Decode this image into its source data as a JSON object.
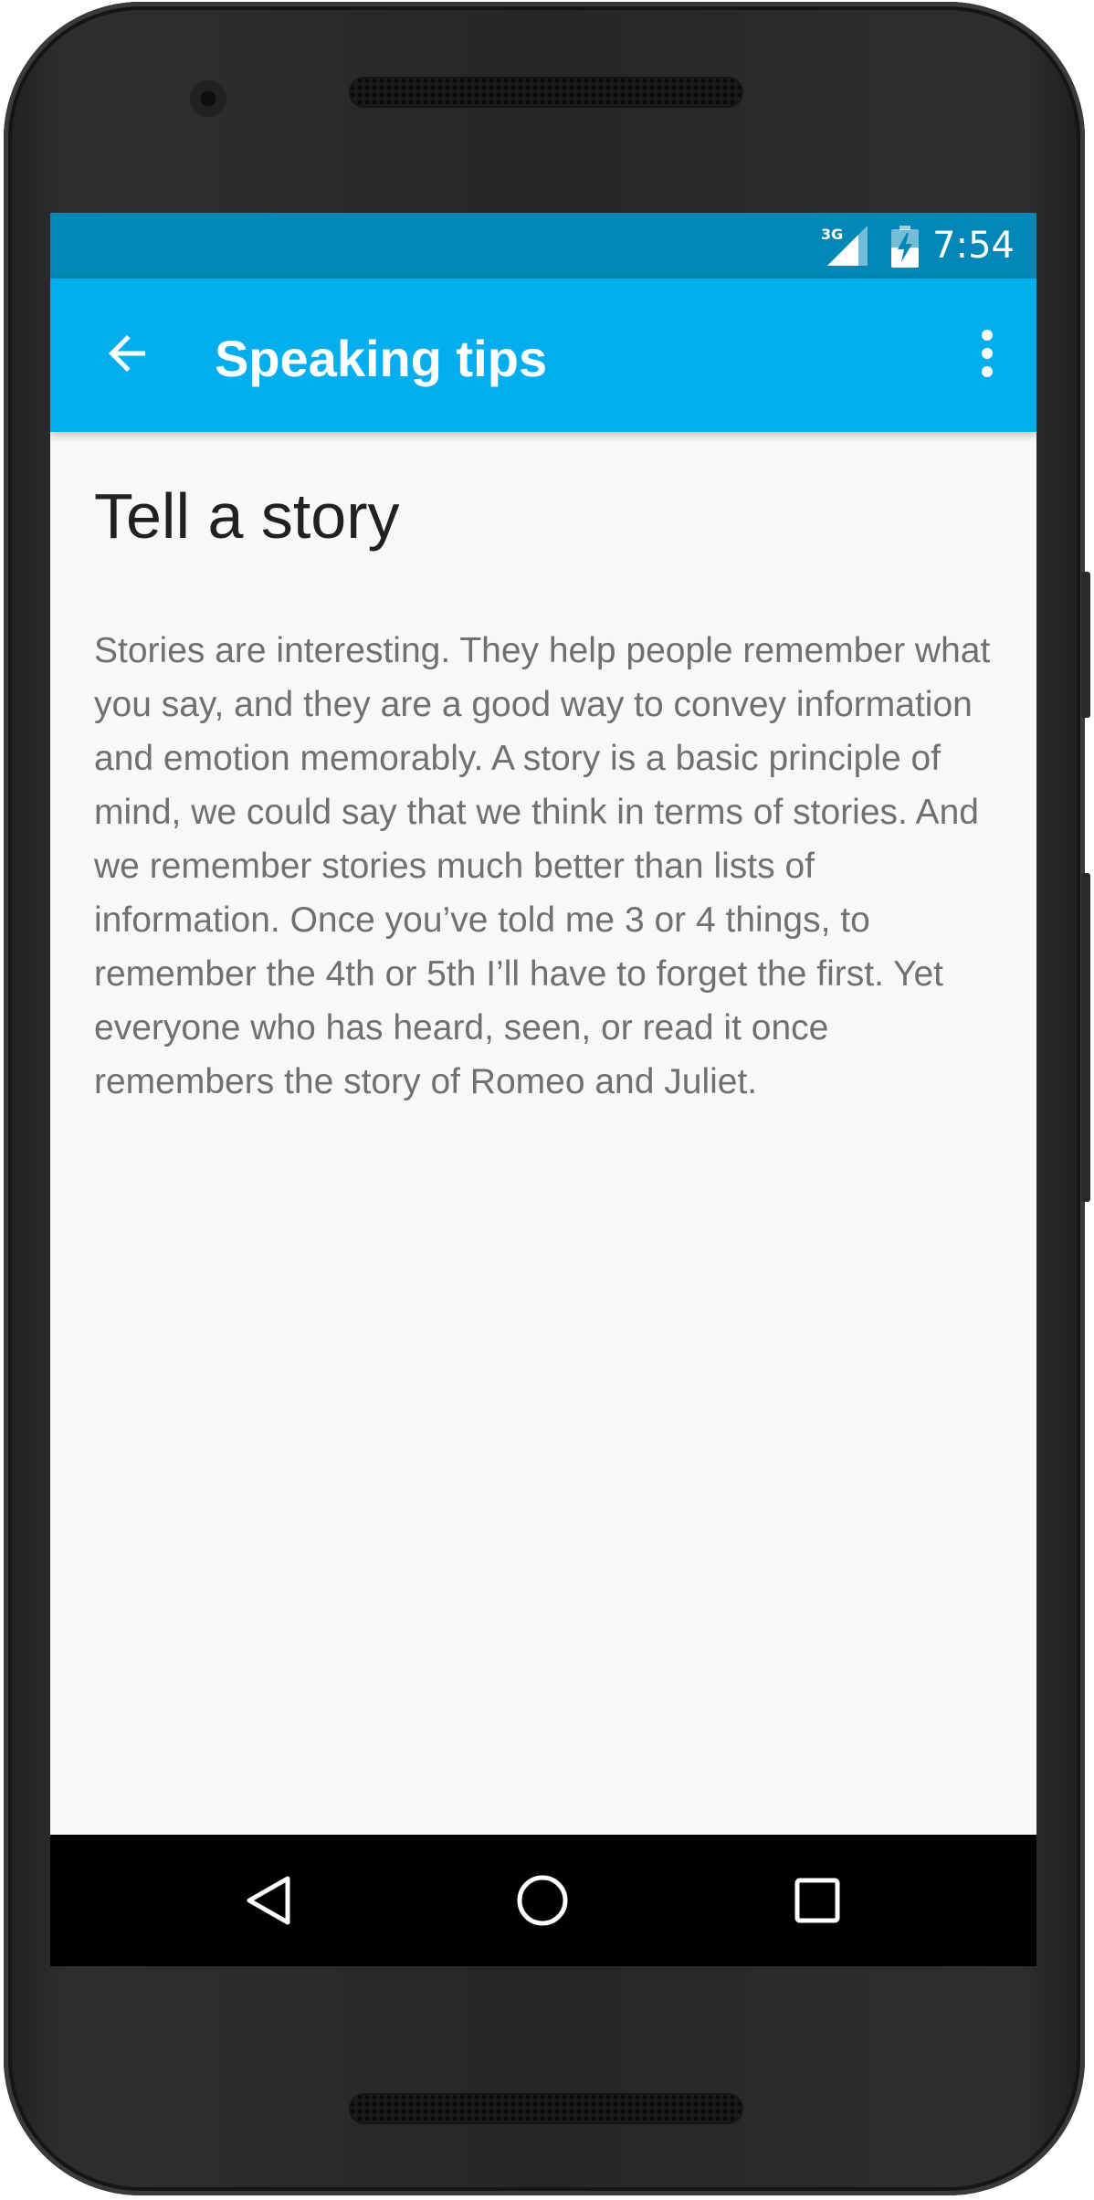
{
  "status_bar": {
    "network": "3G",
    "time": "7:54",
    "signal_icon": "cell-signal-icon",
    "battery_icon": "battery-charging-icon"
  },
  "app_bar": {
    "back_icon": "arrow-back-icon",
    "title": "Speaking tips",
    "menu_icon": "more-vert-icon",
    "color": "#03aeee"
  },
  "content": {
    "heading": "Tell a story",
    "body": "Stories are interesting. They help people remember what you say, and they are a good way to convey information and emotion memorably. A story is a basic principle of mind, we could say that we think in terms of stories. And we remember stories much better than lists of information. Once you’ve told me 3 or 4 things, to remember the 4th or 5th I’ll have to forget the first. Yet everyone who has heard, seen, or read it once remembers the story of Romeo and Juliet."
  },
  "nav_bar": {
    "back_icon": "nav-back-triangle-icon",
    "home_icon": "nav-home-circle-icon",
    "recents_icon": "nav-recents-square-icon"
  },
  "colors": {
    "status_bar": "#0287b6",
    "app_bar": "#03aeee",
    "background": "#f8f8f8"
  }
}
